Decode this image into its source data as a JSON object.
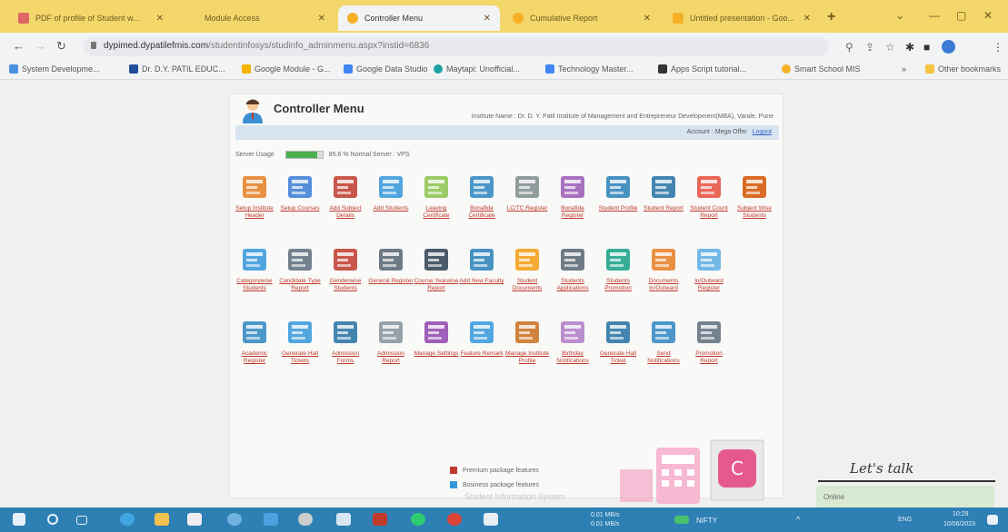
{
  "browser": {
    "tabs": [
      {
        "title": "PDF of profile of Student w...",
        "favicon_color": "#e06666",
        "active": false
      },
      {
        "title": "Module Access",
        "favicon_color": "#f4d76b",
        "active": false
      },
      {
        "title": "Controller Menu",
        "favicon_color": "#f6b026",
        "active": true
      },
      {
        "title": "Cumulative Report",
        "favicon_color": "#f6b026",
        "active": false
      },
      {
        "title": "Untitled presentation - Goo...",
        "favicon_color": "#f6b026",
        "active": false
      }
    ],
    "url_host": "dypimed.dypatilefmis.com",
    "url_path": "/studentinfosys/studinfo_adminmenu.aspx?instid=6836",
    "bookmarks": [
      {
        "label": "System Developme...",
        "color": "#4a90e2"
      },
      {
        "label": "Dr. D.Y. PATIL EDUC...",
        "color": "#1f4e9a"
      },
      {
        "label": "Google Module - G...",
        "color": "#f4b400"
      },
      {
        "label": "Google Data Studio",
        "color": "#4285f4"
      },
      {
        "label": "Maytapi: Unofficial...",
        "color": "#1da1a0"
      },
      {
        "label": "Technology Master...",
        "color": "#4285f4"
      },
      {
        "label": "Apps Script tutorial...",
        "color": "#333333"
      },
      {
        "label": "Smart School MIS",
        "color": "#f6b026"
      }
    ],
    "other_bookmarks": "Other bookmarks"
  },
  "page": {
    "title": "Controller Menu",
    "institute": "Institute Name : Dr. D. Y. Patil Institute of Management and Entrepreneur Development(MBA), Varale, Pune",
    "account": "Account : Mega Offer",
    "logout": "Logout",
    "server_usage_label": "Server Usage",
    "server_usage_percent": 85.6,
    "server_usage_text": "85.6 % Normal  Server : VPS",
    "menu_items": [
      {
        "label": "Setup Institute Header",
        "icon": "school-icon",
        "color": "#e67e22"
      },
      {
        "label": "Setup Courses",
        "icon": "books-icon",
        "color": "#3a7bd5"
      },
      {
        "label": "Add Subject Details",
        "icon": "book-add-icon",
        "color": "#c0392b"
      },
      {
        "label": "Add Students",
        "icon": "students-icon",
        "color": "#3498db"
      },
      {
        "label": "Leaving Certificate",
        "icon": "certificate-icon",
        "color": "#8bc34a"
      },
      {
        "label": "Bonafide Certificate",
        "icon": "document-icon",
        "color": "#2e86c1"
      },
      {
        "label": "LC/TC Register",
        "icon": "register-icon",
        "color": "#7f8c8d"
      },
      {
        "label": "Bonafide Register",
        "icon": "photo-register-icon",
        "color": "#9b59b6"
      },
      {
        "label": "Student Profile",
        "icon": "profile-icon",
        "color": "#2980b9"
      },
      {
        "label": "Student Report",
        "icon": "report-icon",
        "color": "#2471a3"
      },
      {
        "label": "Student Count Report",
        "icon": "bar-chart-icon",
        "color": "#e74c3c"
      },
      {
        "label": "Subject Wise Students",
        "icon": "checklist-icon",
        "color": "#d35400"
      },
      {
        "label": "Categorywise Students",
        "icon": "calendar-list-icon",
        "color": "#3498db"
      },
      {
        "label": "Candidate Type Report",
        "icon": "whiteboard-icon",
        "color": "#5d6d7e"
      },
      {
        "label": "Genderwise Students",
        "icon": "female-icon",
        "color": "#c0392b"
      },
      {
        "label": "General Register",
        "icon": "ledger-icon",
        "color": "#566573"
      },
      {
        "label": "Course Yearwise Report",
        "icon": "monitor-chart-icon",
        "color": "#2c3e50"
      },
      {
        "label": "Add New Faculty",
        "icon": "faculty-icon",
        "color": "#2980b9"
      },
      {
        "label": "Student Documents",
        "icon": "folder-icon",
        "color": "#f39c12"
      },
      {
        "label": "Students Applications",
        "icon": "application-icon",
        "color": "#566573"
      },
      {
        "label": "Students Promotion",
        "icon": "promotion-icon",
        "color": "#16a085"
      },
      {
        "label": "Documents In/Outward",
        "icon": "docs-inout-icon",
        "color": "#e67e22"
      },
      {
        "label": "In/Outward Register",
        "icon": "inout-register-icon",
        "color": "#5dade2"
      },
      {
        "label": "Academic Register",
        "icon": "academic-icon",
        "color": "#2e86c1"
      },
      {
        "label": "Generate Hall Tickets",
        "icon": "hall-ticket-icon",
        "color": "#3498db"
      },
      {
        "label": "Admission Forms",
        "icon": "admission-search-icon",
        "color": "#2471a3"
      },
      {
        "label": "Admission Report",
        "icon": "admission-report-icon",
        "color": "#85929e"
      },
      {
        "label": "Manage Settings",
        "icon": "settings-flower-icon",
        "color": "#8e44ad"
      },
      {
        "label": "Feature Remark",
        "icon": "checkmark-icon",
        "color": "#3498db"
      },
      {
        "label": "Manage Institute Profile",
        "icon": "institute-profile-icon",
        "color": "#ca6f1e"
      },
      {
        "label": "Birthday Notifications",
        "icon": "birthday-cake-icon",
        "color": "#af7ac5"
      },
      {
        "label": "Generate Hall Ticket",
        "icon": "id-card-icon",
        "color": "#2471a3"
      },
      {
        "label": "Send Notifications",
        "icon": "notification-icon",
        "color": "#2e86c1"
      },
      {
        "label": "Promotion Report",
        "icon": "promotion-report-icon",
        "color": "#5d6d7e"
      }
    ],
    "legend": [
      {
        "label": "Premium package features",
        "color": "#c0392b"
      },
      {
        "label": "Business package features",
        "color": "#3498db"
      }
    ],
    "footer_ghost": "Student Information System"
  },
  "chat": {
    "lets_talk": "Let's talk",
    "status": "Online"
  },
  "taskbar": {
    "net_up": "0.01 MB/s",
    "net_down": "0.01 MB/s",
    "nifty": "NIFTY",
    "lang": "ENG",
    "time": "10:29",
    "date": "10/06/2023"
  }
}
